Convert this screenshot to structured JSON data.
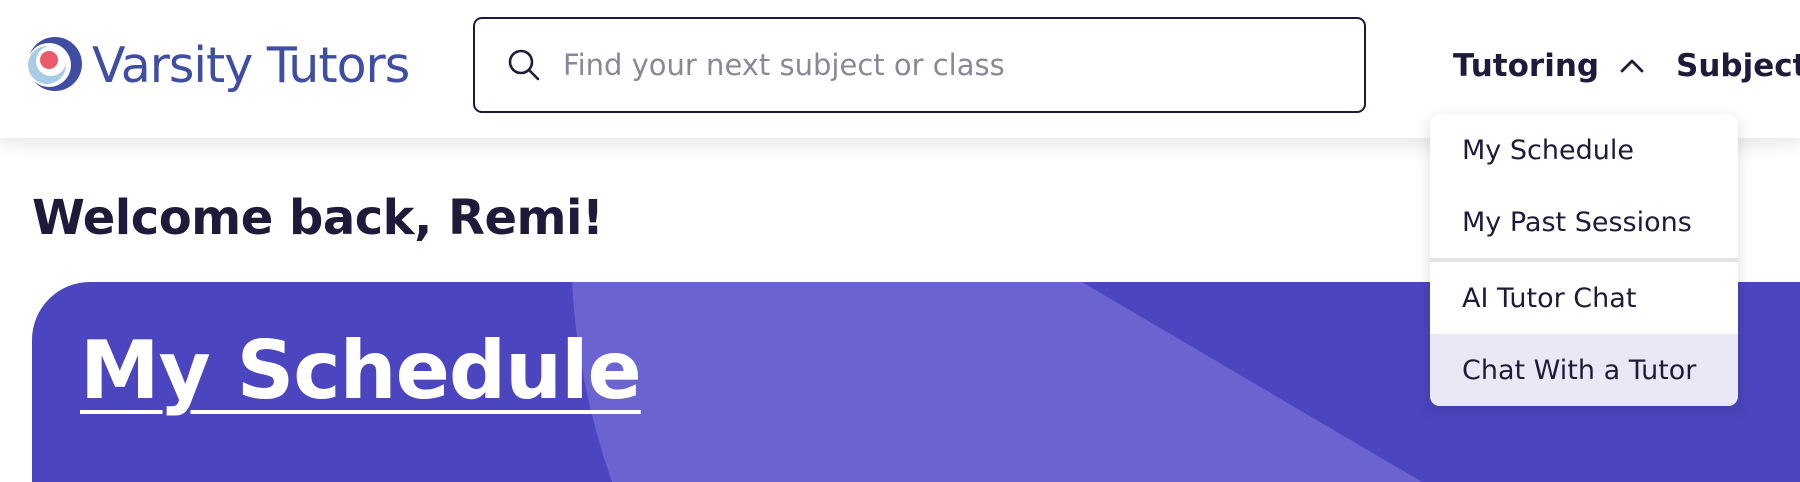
{
  "brand": {
    "name": "Varsity Tutors",
    "logo_icon": "varsity-tutors-logo-icon",
    "color": "#3f4ea3"
  },
  "search": {
    "placeholder": "Find your next subject or class",
    "value": "",
    "icon": "search-icon"
  },
  "nav": {
    "tutoring_label": "Tutoring",
    "tutoring_icon": "chevron-up-icon",
    "subjects_label": "Subjects"
  },
  "dropdown": {
    "items": [
      {
        "label": "My Schedule"
      },
      {
        "label": "My Past Sessions"
      },
      {
        "label": "AI Tutor Chat"
      },
      {
        "label": "Chat With a Tutor",
        "highlighted": true
      }
    ]
  },
  "main": {
    "welcome": "Welcome back, Remi!",
    "hero_title": "My Schedule"
  },
  "colors": {
    "text": "#1e1b3a",
    "hero_bg": "#4b45bf",
    "hero_accent": "#6b63cf",
    "dropdown_highlight": "#ebe8f6"
  }
}
